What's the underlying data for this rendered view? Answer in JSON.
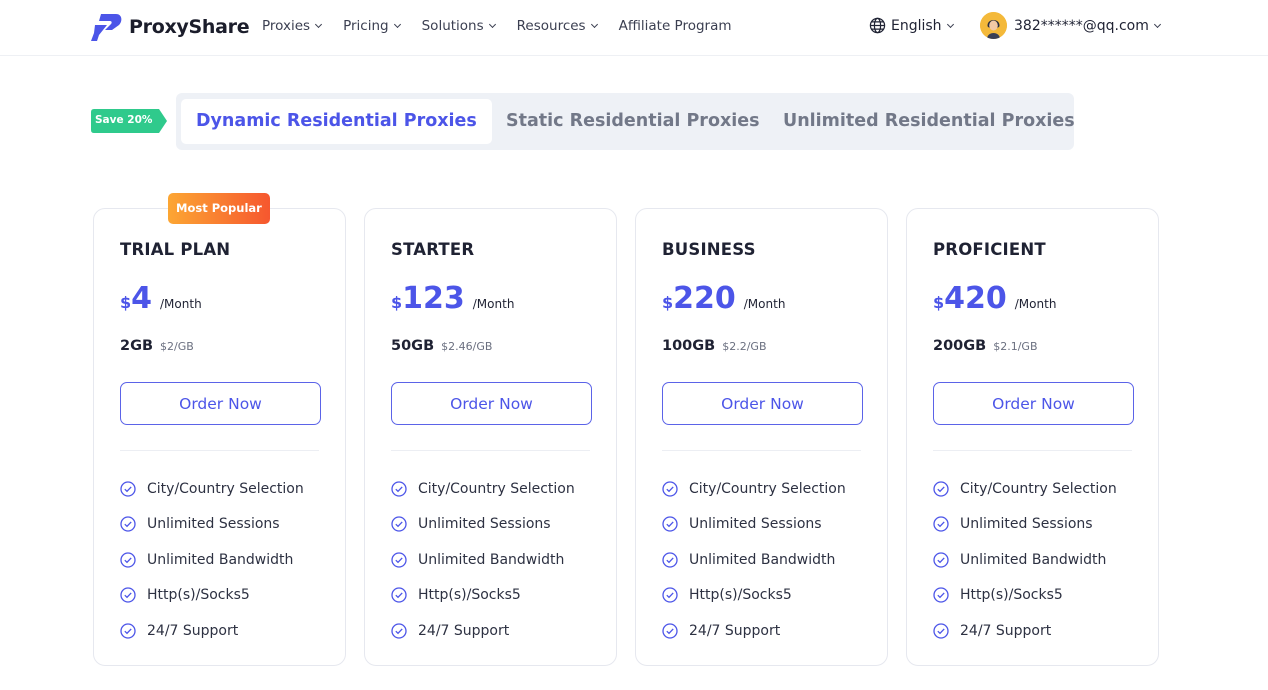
{
  "brand": {
    "name": "ProxyShare",
    "color": "#4c55e8"
  },
  "nav": {
    "menu": [
      {
        "label": "Proxies",
        "has_dropdown": true
      },
      {
        "label": "Pricing",
        "has_dropdown": true
      },
      {
        "label": "Solutions",
        "has_dropdown": true
      },
      {
        "label": "Resources",
        "has_dropdown": true
      },
      {
        "label": "Affiliate Program",
        "has_dropdown": false
      }
    ],
    "language": "English",
    "account_email": "382******@qq.com"
  },
  "plan_tabs": {
    "save_badge": "Save 20%",
    "tabs": [
      {
        "label": "Dynamic Residential Proxies",
        "active": true
      },
      {
        "label": "Static Residential Proxies",
        "active": false
      },
      {
        "label": "Unlimited Residential Proxies",
        "active": false
      }
    ]
  },
  "plans": [
    {
      "name": "TRIAL PLAN",
      "badge": "Most Popular",
      "currency": "$",
      "price": "4",
      "period": "/Month",
      "data_amount": "2GB",
      "per_gb": "$2/GB",
      "button": "Order Now",
      "features": [
        "City/Country Selection",
        "Unlimited Sessions",
        "Unlimited Bandwidth",
        "Http(s)/Socks5",
        "24/7 Support"
      ]
    },
    {
      "name": "STARTER",
      "currency": "$",
      "price": "123",
      "period": "/Month",
      "data_amount": "50GB",
      "per_gb": "$2.46/GB",
      "button": "Order Now",
      "features": [
        "City/Country Selection",
        "Unlimited Sessions",
        "Unlimited Bandwidth",
        "Http(s)/Socks5",
        "24/7 Support"
      ]
    },
    {
      "name": "BUSINESS",
      "currency": "$",
      "price": "220",
      "period": "/Month",
      "data_amount": "100GB",
      "per_gb": "$2.2/GB",
      "button": "Order Now",
      "features": [
        "City/Country Selection",
        "Unlimited Sessions",
        "Unlimited Bandwidth",
        "Http(s)/Socks5",
        "24/7 Support"
      ]
    },
    {
      "name": "PROFICIENT",
      "currency": "$",
      "price": "420",
      "period": "/Month",
      "data_amount": "200GB",
      "per_gb": "$2.1/GB",
      "button": "Order Now",
      "features": [
        "City/Country Selection",
        "Unlimited Sessions",
        "Unlimited Bandwidth",
        "Http(s)/Socks5",
        "24/7 Support"
      ]
    }
  ],
  "colors": {
    "accent": "#4c55e8",
    "save_badge": "#2fca8c",
    "popular_start": "#fca633",
    "popular_end": "#f6572f",
    "tab_bg": "#eef1f6"
  },
  "icons": {
    "logo": "proxyshare-logo-icon",
    "language": "globe-icon",
    "dropdown": "chevron-down-icon",
    "feature": "check-circle-icon"
  }
}
